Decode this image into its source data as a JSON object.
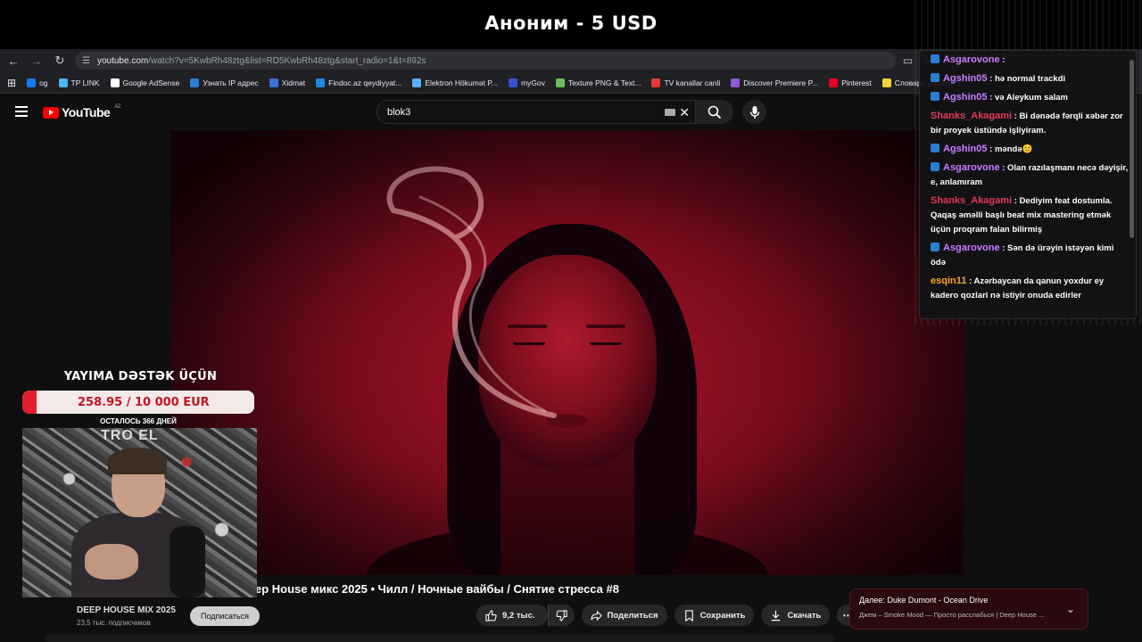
{
  "stream": {
    "title": "Аноним - 5 USD"
  },
  "browser": {
    "url_domain": "youtube.com",
    "url_path": "/watch?v=5KwbRh48ztg&list=RD5KwbRh48ztg&start_radio=1&t=892s",
    "bookmarks": [
      {
        "label": "og",
        "color": "#1877f2"
      },
      {
        "label": "TP LINK",
        "color": "#4fb3ff"
      },
      {
        "label": "Google AdSense",
        "color": "#ffffff"
      },
      {
        "label": "Узнать IP адрес",
        "color": "#2e7dd7"
      },
      {
        "label": "Xidmat",
        "color": "#3b6fd6"
      },
      {
        "label": "Findoc.az qeydiyyat...",
        "color": "#1e88e5"
      },
      {
        "label": "Elektron Hökumət P...",
        "color": "#5ab0ff"
      },
      {
        "label": "myGov",
        "color": "#3a4fd1"
      },
      {
        "label": "Texture PNG & Text...",
        "color": "#6ac05c"
      },
      {
        "label": "TV kanallar canli",
        "color": "#e53935"
      },
      {
        "label": "Discover Premiere P...",
        "color": "#8e5bd4"
      },
      {
        "label": "Pinterest",
        "color": "#e60023"
      },
      {
        "label": "Словарь игровых т...",
        "color": "#f5d33a"
      }
    ]
  },
  "youtube": {
    "logo_text": "YouTube",
    "region": "AZ",
    "search_value": "blok3"
  },
  "video": {
    "title": "ep House микс 2025 • Чилл / Ночные вайбы / Снятие стресса #8",
    "channel": "DEEP HOUSE MIX 2025",
    "subscribers": "23,5 тыс. подписчиков",
    "subscribe_label": "Подписаться",
    "likes": "9,2 тыс.",
    "share_label": "Поделиться",
    "save_label": "Сохранить",
    "download_label": "Скачать"
  },
  "up_next": {
    "title": "Далее: Duke Dumont - Ocean Drive",
    "subtitle": "Джем – Smoke Mood — Просто расслабься | Deep House ..."
  },
  "chat": [
    {
      "user": "Asgarovone",
      "color": "#c77dff",
      "badge": true,
      "text": ""
    },
    {
      "user": "Agshin05",
      "color": "#c77dff",
      "badge": true,
      "text": "hə normal trackdi"
    },
    {
      "user": "Agshin05",
      "color": "#c77dff",
      "badge": true,
      "text": "və Aleykum salam"
    },
    {
      "user": "Shanks_Akagami",
      "color": "#e03a56",
      "badge": false,
      "text": "Bi dənədə fərqli xəbər zor bir proyek üstündə işliyiram."
    },
    {
      "user": "Agshin05",
      "color": "#c77dff",
      "badge": true,
      "text": "məndə😊"
    },
    {
      "user": "Asgarovone",
      "color": "#c77dff",
      "badge": true,
      "text": "Olan razılaşmanı necə dəyişir, e, anlamıram"
    },
    {
      "user": "Shanks_Akagami",
      "color": "#e03a56",
      "badge": false,
      "text": "Dediyim feat dostumla. Qaqaş əməlli başlı beat mix mastering etmək üçün proqram falan bilirmiş"
    },
    {
      "user": "Asgarovone",
      "color": "#c77dff",
      "badge": true,
      "text": "Sən də ürəyin istəyən kimi ödə"
    },
    {
      "user": "esqin11",
      "color": "#f5a623",
      "badge": false,
      "text": "Azərbaycan da qanun yoxdur ey kadero qozlari nə istiyir onuda edirler"
    }
  ],
  "donation": {
    "heading": "YAYIMA DƏSTƏK ÜÇÜN",
    "amount_text": "258.95 / 10 000 EUR",
    "raised": 258.95,
    "goal": 10000,
    "days_left": "ОСТАЛОСЬ 366 ДНЕЙ"
  },
  "webcam": {
    "sign_text": "TRO EL"
  }
}
